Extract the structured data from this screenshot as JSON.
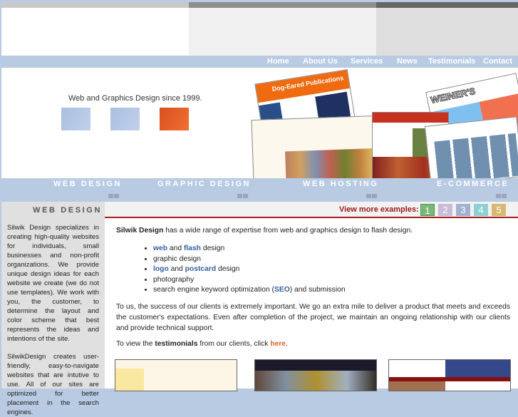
{
  "nav": [
    "Home",
    "About Us",
    "Services",
    "News",
    "Testimonials",
    "Contact"
  ],
  "hero": {
    "tagline": "Web and Graphics Design since 1999.",
    "collage_labels": [
      "Dog-Eared Publications",
      "WEINER'S"
    ]
  },
  "categories": [
    "WEB DESIGN",
    "GRAPHIC DESIGN",
    "WEB HOSTING",
    "E-COMMERCE"
  ],
  "sidebar": {
    "title": "WEB DESIGN",
    "p1": "Silwik Design specializes in creating high-quality websites for individuals, small businesses and non-profit organizations. We provide unique design ideas for each website we create (we do not use templates). We work with you, the customer, to determine the layout and color scheme that best represents the ideas and intentions of the site.",
    "p2": "SilwikDesign creates user-friendly, easy-to-navigate websites that are intutive to use. All of our sites are optimized for better placement in the search engines."
  },
  "examples": {
    "label": "View more examples:",
    "pages": [
      "1",
      "2",
      "3",
      "4",
      "5"
    ],
    "colors": [
      "#7ab87a",
      "#c8bcd8",
      "#9fb2d2",
      "#8ed0d4",
      "#d8b870"
    ]
  },
  "main": {
    "intro_bold": "Silwik Design",
    "intro_rest": " has a wide range of expertise from web and graphics design to flash design.",
    "b1": {
      "l1": "web",
      "t1": " and ",
      "l2": "flash",
      "t2": " design"
    },
    "b2": "graphic design",
    "b3": {
      "l1": "logo",
      "t1": " and ",
      "l2": "postcard",
      "t2": " design"
    },
    "b4": "photography",
    "b5": {
      "t1": "search engine keyword optimization (",
      "l1": "SEO",
      "t2": ") and submission"
    },
    "para": "To us, the success of our clients is extremely important. We go an extra mile to deliver a product that meets and exceeds the customer's expectations. Even after completion of the project, we maintain an ongoing relationship with our clients and provide technical support.",
    "testi": {
      "t1": "To view the ",
      "bold": "testimonials",
      "t2": " from our clients, click ",
      "link": "here",
      "t3": "."
    }
  }
}
